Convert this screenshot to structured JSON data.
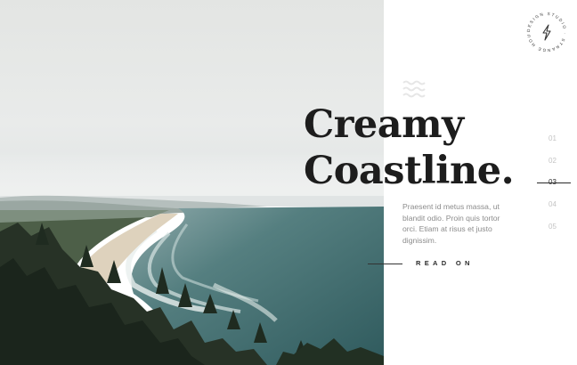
{
  "logo": {
    "ring_text": "DESIGN STUDIO · STRANGE HOUSE",
    "icon": "lightning-bolt-icon"
  },
  "decor": {
    "icon": "wave-icon"
  },
  "hero": {
    "image": "coastline-photo",
    "headline_line1": "Creamy",
    "headline_line2": "Coastline.",
    "body": "Praesent id metus massa, ut blandit odio. Proin quis tortor orci. Etiam at risus et justo dignissim."
  },
  "cta": {
    "label": "READ ON"
  },
  "pager": {
    "items": [
      {
        "label": "01"
      },
      {
        "label": "02"
      },
      {
        "label": "03"
      },
      {
        "label": "04"
      },
      {
        "label": "05"
      }
    ],
    "active_index": 2
  },
  "colors": {
    "text_dark": "#1d1d1d",
    "text_muted": "#8c8c8c",
    "pager_inactive": "#c4c4c4",
    "sea": "#3f6e6c"
  }
}
